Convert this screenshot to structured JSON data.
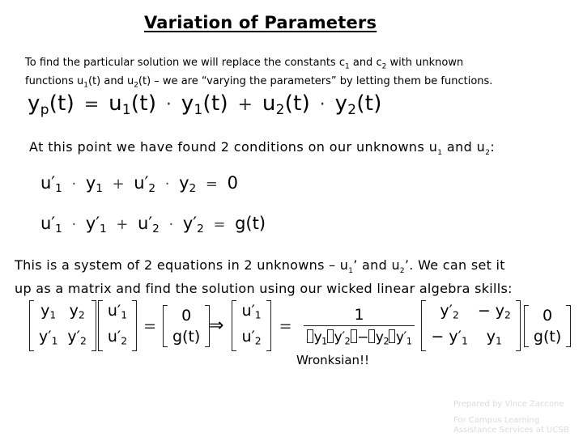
{
  "title": "Variation of Parameters",
  "intro": {
    "line1_a": "To find the particular solution we will replace the constants c",
    "line1_sub1": "1",
    "line1_b": " and c",
    "line1_sub2": "2",
    "line1_c": " with unknown",
    "line2_a": "functions u",
    "line2_sub1": "1",
    "line2_b": "(t) and u",
    "line2_sub2": "2",
    "line2_c": "(t) – we are “varying the parameters” by letting them be functions."
  },
  "main_equation": {
    "lhs": "y",
    "lhs_sub": "p",
    "lhs_arg": "(t)",
    "eq": "=",
    "t1": "u",
    "t1_sub": "1",
    "t1_arg": "(t)",
    "dot": "·",
    "t2": "y",
    "t2_sub": "1",
    "t2_arg": "(t)",
    "plus": "+",
    "t3": "u",
    "t3_sub": "2",
    "t3_arg": "(t)",
    "t4": "y",
    "t4_sub": "2",
    "t4_arg": "(t)"
  },
  "conditions": {
    "text_a": "At this point we have found 2 conditions on our unknowns u",
    "sub1": "1",
    "text_b": " and u",
    "sub2": "2",
    "text_c": ":",
    "eq1": {
      "a": "u′",
      "a_sub": "1",
      "dot": "·",
      "b": "y",
      "b_sub": "1",
      "plus": "+",
      "c": "u′",
      "c_sub": "2",
      "d": "y",
      "d_sub": "2",
      "eq": "=",
      "rhs": "0"
    },
    "eq2": {
      "a": "u′",
      "a_sub": "1",
      "dot": "·",
      "b": "y′",
      "b_sub": "1",
      "plus": "+",
      "c": "u′",
      "c_sub": "2",
      "d": "y′",
      "d_sub": "2",
      "eq": "=",
      "rhs": "g(t)"
    }
  },
  "system": {
    "line1_a": "This is a system of 2 equations in 2 unknowns – u",
    "sub1": "1",
    "line1_b": "’ and u",
    "sub2": "2",
    "line1_c": "’. We can set it",
    "line2": "up as a matrix and find the solution using our wicked linear algebra skills:"
  },
  "matrix_eq": {
    "A": [
      [
        "y1",
        "y2"
      ],
      [
        "y1′",
        "y2′"
      ]
    ],
    "A_display": [
      [
        "y",
        "1",
        ""
      ],
      [
        "y",
        "2",
        ""
      ],
      [
        "y′",
        "1",
        ""
      ],
      [
        "y′",
        "2",
        ""
      ]
    ],
    "x": [
      "u′1",
      "u′2"
    ],
    "b": [
      "0",
      "g(t)"
    ],
    "eq": "=",
    "implies": "⇒",
    "numerator": "1",
    "denominator": "y1y2′ − y2y1′",
    "inverse": [
      [
        "y2′",
        "− y2"
      ],
      [
        "− y1′",
        "y1"
      ]
    ],
    "annotation": "Wronksian!!"
  },
  "footer": {
    "line1": "Prepared by Vince Zaccone",
    "line2": "For Campus Learning",
    "line3": "Assistance Services at UCSB"
  }
}
